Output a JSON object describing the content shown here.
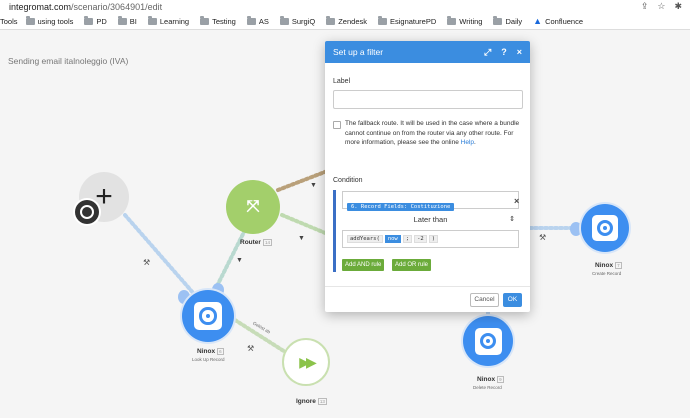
{
  "browser": {
    "url_host": "integromat.com",
    "url_path": "/scenario/3064901/edit",
    "bookmarks": [
      "using tools",
      "PD",
      "BI",
      "Learning",
      "Testing",
      "AS",
      "SurgiQ",
      "Zendesk",
      "EsignaturePD",
      "Writing",
      "Daily",
      "Confluence"
    ],
    "first_cut_label": "Tools"
  },
  "scenario": {
    "title": "Sending email italnoleggio (IVA)"
  },
  "modules": {
    "router": {
      "label": "Router",
      "index": "14"
    },
    "lookup": {
      "label": "Ninox",
      "index": "6",
      "sub": "Look Up Record"
    },
    "ignore": {
      "label": "Ignore",
      "index": "13"
    },
    "create": {
      "label": "Ninox",
      "index": "7",
      "sub": "Create Record"
    },
    "delete": {
      "label": "Ninox",
      "index": "9",
      "sub": "Delete Record"
    },
    "link_label": "Gelöst ab"
  },
  "modal": {
    "title": "Set up a filter",
    "label_caption": "Label",
    "label_value": "",
    "fallback_text": "The fallback route. It will be used in the case where a bundle cannot continue on from the router via any other route. For more information, please see the online ",
    "fallback_link": "Help",
    "fallback_end": ".",
    "condition_caption": "Condition",
    "field_pill": "6. Record Fields: Costituzione",
    "operator": "Later than",
    "value_func": "addYears(",
    "value_now": "now",
    "value_sep": ";",
    "value_arg": "-2",
    "value_close": ")",
    "add_and": "Add AND rule",
    "add_or": "Add OR rule",
    "cancel": "Cancel",
    "ok": "OK"
  },
  "colors": {
    "accent": "#3b8de0",
    "router_green": "#a3cf6b",
    "ninox_blue": "#3d8ef0",
    "rule_green": "#6bab3a"
  }
}
